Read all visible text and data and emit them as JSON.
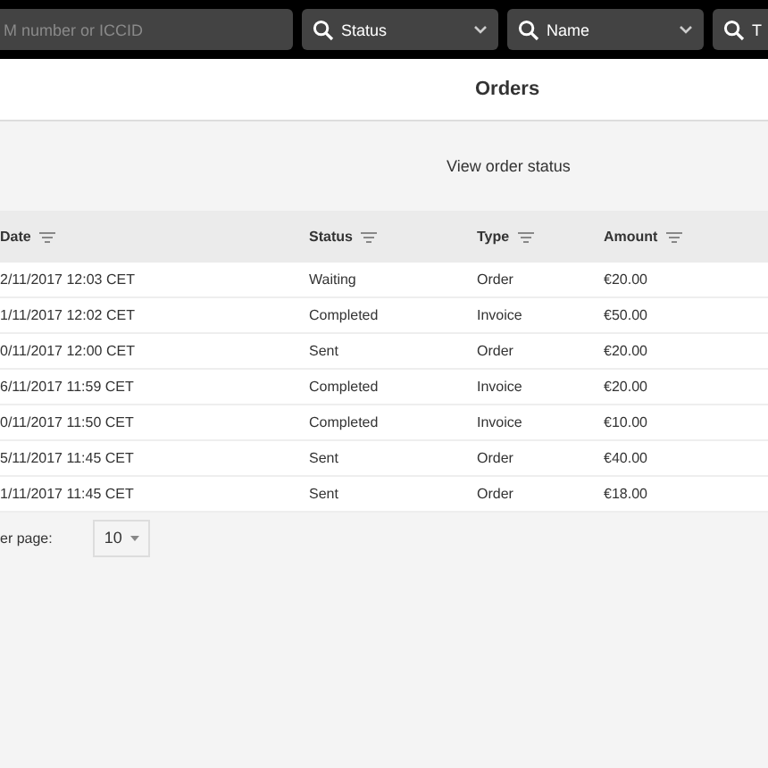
{
  "filters": [
    {
      "kind": "text",
      "placeholder": "M number or ICCID"
    },
    {
      "kind": "select",
      "label": "Status"
    },
    {
      "kind": "select",
      "label": "Name"
    },
    {
      "kind": "select",
      "label": "T"
    }
  ],
  "header": {
    "title": "Orders"
  },
  "subheader": {
    "text": "View order status"
  },
  "table": {
    "columns": [
      "Date",
      "Status",
      "Type",
      "Amount"
    ],
    "rows": [
      [
        "2/11/2017 12:03 CET",
        "Waiting",
        "Order",
        "€20.00"
      ],
      [
        "1/11/2017 12:02 CET",
        "Completed",
        "Invoice",
        "€50.00"
      ],
      [
        "0/11/2017 12:00 CET",
        "Sent",
        "Order",
        "€20.00"
      ],
      [
        "6/11/2017 11:59 CET",
        "Completed",
        "Invoice",
        "€20.00"
      ],
      [
        "0/11/2017 11:50 CET",
        "Completed",
        "Invoice",
        "€10.00"
      ],
      [
        "5/11/2017 11:45 CET",
        "Sent",
        "Order",
        "€40.00"
      ],
      [
        "1/11/2017 11:45 CET",
        "Sent",
        "Order",
        "€18.00"
      ]
    ]
  },
  "pagination": {
    "label": "er page:",
    "value": "10"
  }
}
